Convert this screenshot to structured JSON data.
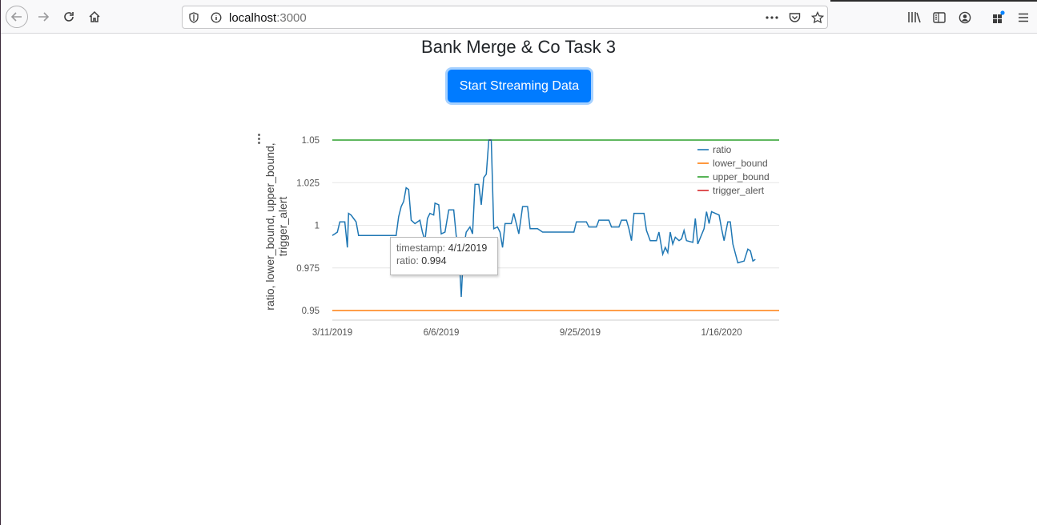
{
  "browser": {
    "url_host": "localhost",
    "url_port": ":3000"
  },
  "page": {
    "title": "Bank Merge & Co Task 3",
    "stream_button_label": "Start Streaming Data"
  },
  "tooltip": {
    "label1": "timestamp:",
    "value1": "4/1/2019",
    "label2": "ratio:",
    "value2": "0.994"
  },
  "colors": {
    "ratio": "#1f77b4",
    "lower_bound": "#ff7f0e",
    "upper_bound": "#2ca02c",
    "trigger_alert": "#d62728",
    "button": "#007bff"
  },
  "chart_data": {
    "type": "line",
    "ylabel": "ratio, lower_bound, upper_bound, trigger_alert",
    "ylim": [
      0.945,
      1.05
    ],
    "yticks": [
      0.95,
      0.975,
      1,
      1.025,
      1.05
    ],
    "ytick_labels": [
      "0.95",
      "0.975",
      "1",
      "1.025",
      "1.05"
    ],
    "xlim": [
      "2019-03-11",
      "2020-03-02"
    ],
    "xticks": [
      "2019-03-11",
      "2019-06-06",
      "2019-09-25",
      "2020-01-16"
    ],
    "xtick_labels": [
      "3/11/2019",
      "6/6/2019",
      "9/25/2019",
      "1/16/2020"
    ],
    "legend_position": "top-right",
    "series": [
      {
        "name": "ratio",
        "points": [
          [
            "2019-03-11",
            0.994
          ],
          [
            "2019-03-13",
            0.995
          ],
          [
            "2019-03-15",
            0.996
          ],
          [
            "2019-03-17",
            1.002
          ],
          [
            "2019-03-21",
            1.002
          ],
          [
            "2019-03-23",
            0.987
          ],
          [
            "2019-03-24",
            1.007
          ],
          [
            "2019-03-26",
            1.006
          ],
          [
            "2019-03-28",
            1.004
          ],
          [
            "2019-03-30",
            1.002
          ],
          [
            "2019-04-01",
            0.994
          ],
          [
            "2019-04-06",
            0.994
          ],
          [
            "2019-04-16",
            0.994
          ],
          [
            "2019-04-26",
            0.994
          ],
          [
            "2019-05-01",
            0.994
          ],
          [
            "2019-05-03",
            1.005
          ],
          [
            "2019-05-05",
            1.011
          ],
          [
            "2019-05-07",
            1.014
          ],
          [
            "2019-05-09",
            1.022
          ],
          [
            "2019-05-11",
            1.021
          ],
          [
            "2019-05-13",
            1.003
          ],
          [
            "2019-05-16",
            1.001
          ],
          [
            "2019-05-20",
            1.003
          ],
          [
            "2019-05-22",
            0.996
          ],
          [
            "2019-05-24",
            0.991
          ],
          [
            "2019-05-26",
            1.004
          ],
          [
            "2019-05-28",
            1.007
          ],
          [
            "2019-05-31",
            1.006
          ],
          [
            "2019-06-01",
            1.013
          ],
          [
            "2019-06-04",
            1.012
          ],
          [
            "2019-06-06",
            0.995
          ],
          [
            "2019-06-09",
            0.996
          ],
          [
            "2019-06-12",
            1.009
          ],
          [
            "2019-06-16",
            1.009
          ],
          [
            "2019-06-18",
            0.994
          ],
          [
            "2019-06-20",
            0.987
          ],
          [
            "2019-06-22",
            0.958
          ],
          [
            "2019-06-24",
            0.987
          ],
          [
            "2019-06-26",
            0.996
          ],
          [
            "2019-06-29",
            0.999
          ],
          [
            "2019-07-01",
            0.995
          ],
          [
            "2019-07-03",
            1.024
          ],
          [
            "2019-07-06",
            1.024
          ],
          [
            "2019-07-08",
            1.012
          ],
          [
            "2019-07-10",
            1.028
          ],
          [
            "2019-07-12",
            1.03
          ],
          [
            "2019-07-14",
            1.05
          ],
          [
            "2019-07-16",
            1.05
          ],
          [
            "2019-07-18",
            0.998
          ],
          [
            "2019-07-21",
            0.999
          ],
          [
            "2019-07-23",
            0.996
          ],
          [
            "2019-07-25",
            0.987
          ],
          [
            "2019-07-27",
            1.001
          ],
          [
            "2019-08-01",
            1.001
          ],
          [
            "2019-08-03",
            1.007
          ],
          [
            "2019-08-05",
            1.001
          ],
          [
            "2019-08-07",
            0.995
          ],
          [
            "2019-08-10",
            1.011
          ],
          [
            "2019-08-14",
            1.011
          ],
          [
            "2019-08-16",
            0.998
          ],
          [
            "2019-08-22",
            0.998
          ],
          [
            "2019-08-26",
            0.996
          ],
          [
            "2019-09-05",
            0.996
          ],
          [
            "2019-09-15",
            0.996
          ],
          [
            "2019-09-20",
            0.996
          ],
          [
            "2019-09-22",
            1.002
          ],
          [
            "2019-09-26",
            1.002
          ],
          [
            "2019-09-30",
            1.002
          ],
          [
            "2019-10-02",
            0.999
          ],
          [
            "2019-10-08",
            0.999
          ],
          [
            "2019-10-10",
            1.003
          ],
          [
            "2019-10-18",
            1.003
          ],
          [
            "2019-10-20",
            0.999
          ],
          [
            "2019-10-26",
            0.999
          ],
          [
            "2019-10-28",
            1.003
          ],
          [
            "2019-11-01",
            1.003
          ],
          [
            "2019-11-03",
            0.998
          ],
          [
            "2019-11-05",
            0.991
          ],
          [
            "2019-11-07",
            1.007
          ],
          [
            "2019-11-15",
            1.007
          ],
          [
            "2019-11-17",
            0.997
          ],
          [
            "2019-11-20",
            0.991
          ],
          [
            "2019-11-25",
            0.991
          ],
          [
            "2019-11-27",
            0.996
          ],
          [
            "2019-11-30",
            0.983
          ],
          [
            "2019-12-02",
            0.987
          ],
          [
            "2019-12-04",
            0.984
          ],
          [
            "2019-12-06",
            0.996
          ],
          [
            "2019-12-08",
            0.989
          ],
          [
            "2019-12-10",
            0.993
          ],
          [
            "2019-12-13",
            0.991
          ],
          [
            "2019-12-15",
            0.992
          ],
          [
            "2019-12-17",
            0.997
          ],
          [
            "2019-12-19",
            0.991
          ],
          [
            "2019-12-24",
            0.99
          ],
          [
            "2019-12-26",
            1.004
          ],
          [
            "2019-12-28",
            0.989
          ],
          [
            "2020-01-02",
            0.998
          ],
          [
            "2020-01-04",
            1.008
          ],
          [
            "2020-01-06",
            1.001
          ],
          [
            "2020-01-08",
            1.008
          ],
          [
            "2020-01-14",
            1.006
          ],
          [
            "2020-01-16",
            0.998
          ],
          [
            "2020-01-18",
            0.991
          ],
          [
            "2020-01-21",
            1.002
          ],
          [
            "2020-01-23",
            1.002
          ],
          [
            "2020-01-25",
            0.989
          ],
          [
            "2020-01-29",
            0.978
          ],
          [
            "2020-02-03",
            0.979
          ],
          [
            "2020-02-06",
            0.986
          ],
          [
            "2020-02-08",
            0.985
          ],
          [
            "2020-02-10",
            0.979
          ],
          [
            "2020-02-12",
            0.98
          ]
        ]
      },
      {
        "name": "lower_bound",
        "points": [
          [
            "2019-03-11",
            0.95
          ],
          [
            "2020-03-02",
            0.95
          ]
        ]
      },
      {
        "name": "upper_bound",
        "points": [
          [
            "2019-03-11",
            1.05
          ],
          [
            "2020-03-02",
            1.05
          ]
        ]
      },
      {
        "name": "trigger_alert",
        "points": [
          [
            "2019-07-14",
            1.05
          ],
          [
            "2019-07-16",
            1.05
          ]
        ]
      }
    ]
  }
}
